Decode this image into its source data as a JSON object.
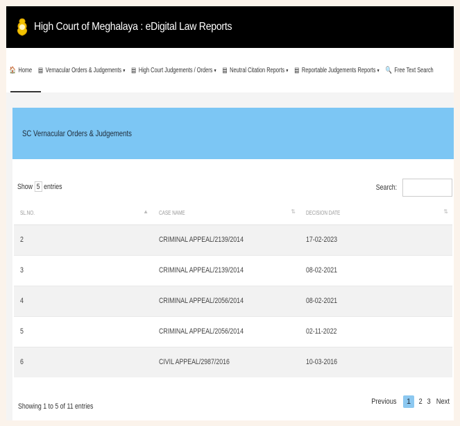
{
  "header": {
    "title": "High Court of Meghalaya : eDigital Law Reports"
  },
  "nav": {
    "items": [
      {
        "icon": "home-icon",
        "glyph": "🏠",
        "label": "Home",
        "dropdown": false
      },
      {
        "icon": "list-icon",
        "glyph": "▤",
        "label": "Vernacular Orders & Judgements",
        "dropdown": true
      },
      {
        "icon": "list-icon",
        "glyph": "▤",
        "label": "High Court Judgements / Orders",
        "dropdown": true
      },
      {
        "icon": "list-icon",
        "glyph": "▤",
        "label": "Neutral Citation Reports",
        "dropdown": true
      },
      {
        "icon": "list-icon",
        "glyph": "▤",
        "label": "Reportable Judgements Reports",
        "dropdown": true
      },
      {
        "icon": "search-icon",
        "glyph": "🔍",
        "label": "Free Text Search",
        "dropdown": false
      }
    ]
  },
  "panel": {
    "title": "SC Vernacular Orders & Judgements"
  },
  "controls": {
    "show_prefix": "Show",
    "show_value": "5",
    "show_suffix": "entries",
    "search_label": "Search:",
    "search_value": ""
  },
  "table": {
    "columns": [
      "SL.NO.",
      "CASE NAME",
      "DECISION DATE"
    ],
    "rows": [
      [
        "2",
        "CRIMINAL APPEAL/2139/2014",
        "17-02-2023"
      ],
      [
        "3",
        "CRIMINAL APPEAL/2139/2014",
        "08-02-2021"
      ],
      [
        "4",
        "CRIMINAL APPEAL/2056/2014",
        "08-02-2021"
      ],
      [
        "5",
        "CRIMINAL APPEAL/2056/2014",
        "02-11-2022"
      ],
      [
        "6",
        "CIVIL APPEAL/2987/2016",
        "10-03-2016"
      ]
    ]
  },
  "footer": {
    "info": "Showing 1 to 5 of 11 entries",
    "pagination": {
      "previous": "Previous",
      "pages": [
        "1",
        "2",
        "3"
      ],
      "active": "1",
      "next": "Next"
    }
  },
  "colors": {
    "panel_header": "#7cc6f4",
    "titlebar": "#000000",
    "active_page": "#8cc8f0"
  }
}
